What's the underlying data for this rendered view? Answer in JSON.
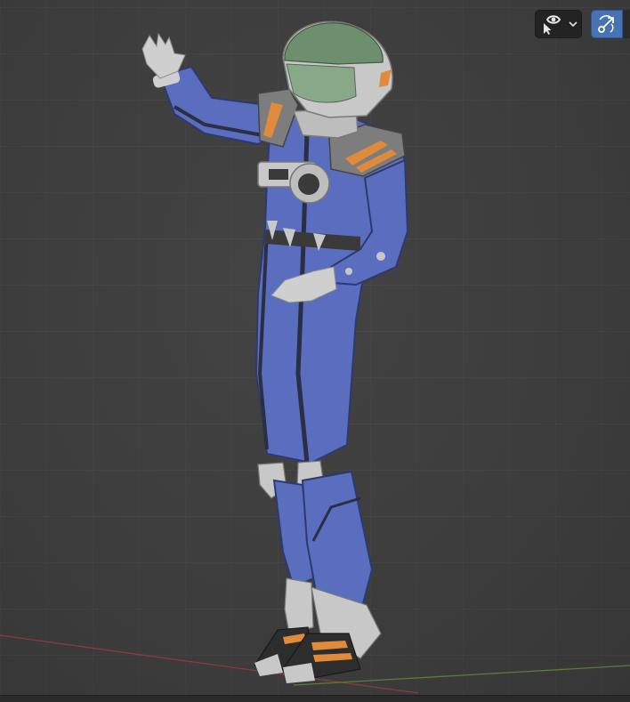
{
  "viewport": {
    "background_color": "#3d3d3d",
    "axis_x_color": "#8a3a44",
    "axis_y_color": "#5e7a36"
  },
  "toolbar": {
    "visibility_icon": "eye-arrow-icon",
    "visibility_dropdown_icon": "chevron-down-icon",
    "gizmo_icon": "gizmo-icon",
    "gizmo_active_color": "#4772b3"
  },
  "model": {
    "suit_color": "#5a6dbf",
    "armor_color": "#c8c8c8",
    "stripe_color": "#e08a3c",
    "visor_color": "#6d8f6e"
  }
}
